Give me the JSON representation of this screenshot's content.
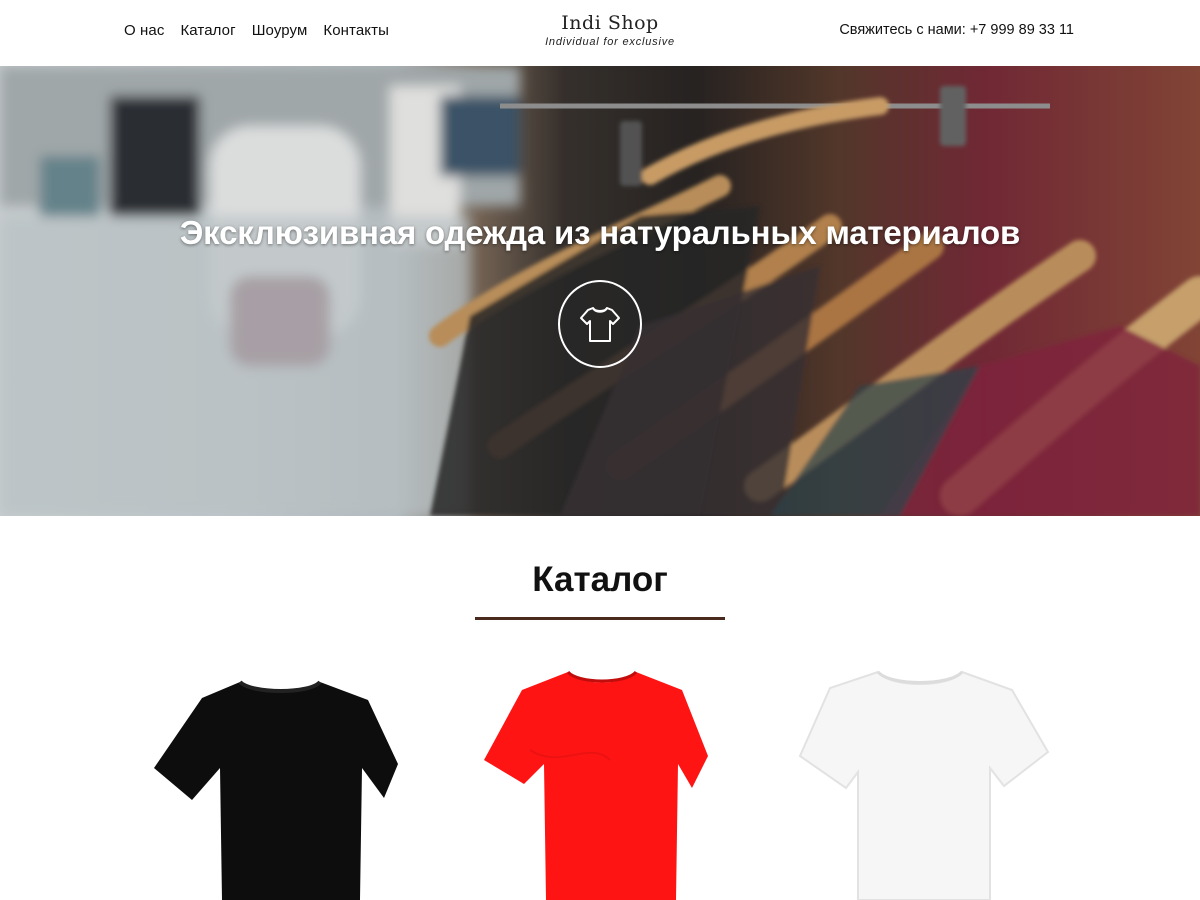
{
  "header": {
    "nav": [
      "О нас",
      "Каталог",
      "Шоурум",
      "Контакты"
    ],
    "logo_title": "Indi Shop",
    "logo_subtitle": "Individual for exclusive",
    "contact_label": "Свяжитесь с нами:",
    "contact_phone": "+7 999 89 33 11"
  },
  "hero": {
    "title": "Эксклюзивная одежда из натуральных материалов",
    "icon": "tshirt-icon"
  },
  "catalog": {
    "title": "Каталог",
    "accent_color": "#4a2a1c",
    "products": [
      {
        "image": "black-tshirt",
        "color": "#111111"
      },
      {
        "image": "red-tshirt",
        "color": "#ff1a1a"
      },
      {
        "image": "white-tshirt",
        "color": "#f7f7f7"
      }
    ]
  }
}
